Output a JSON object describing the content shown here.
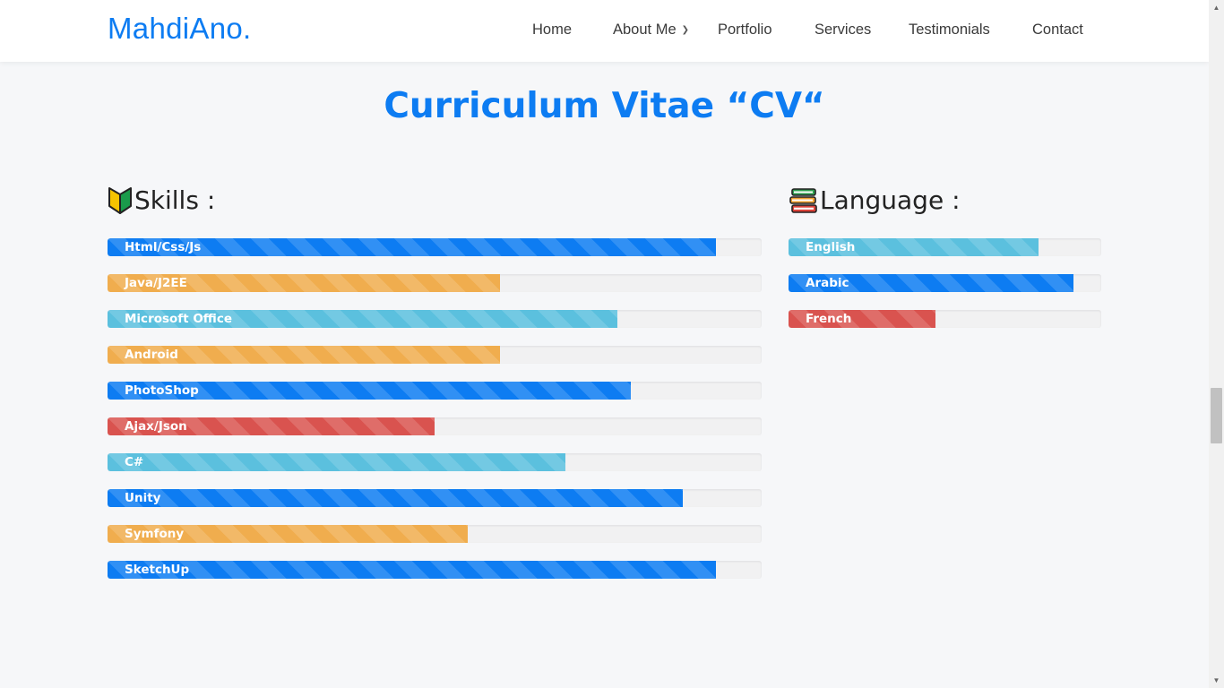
{
  "nav": {
    "brand": "MahdiAno.",
    "items": [
      {
        "label": "Home"
      },
      {
        "label": "About Me",
        "dropdown": true
      },
      {
        "label": "Portfolio"
      },
      {
        "label": "Services"
      },
      {
        "label": "Testimonials"
      },
      {
        "label": "Contact"
      }
    ]
  },
  "title": "Curriculum Vitae “CV“",
  "skills": {
    "heading": "Skills :",
    "icon": "beginner-mark-icon",
    "items": [
      {
        "label": "Html/Css/Js",
        "percent": 93,
        "color": "#0d7cf2"
      },
      {
        "label": "Java/J2EE",
        "percent": 60,
        "color": "#f0ad4e"
      },
      {
        "label": "Microsoft Office",
        "percent": 78,
        "color": "#5bc0de"
      },
      {
        "label": "Android",
        "percent": 60,
        "color": "#f0ad4e"
      },
      {
        "label": "PhotoShop",
        "percent": 80,
        "color": "#0d7cf2"
      },
      {
        "label": "Ajax/Json",
        "percent": 50,
        "color": "#d9534f"
      },
      {
        "label": "C#",
        "percent": 70,
        "color": "#5bc0de"
      },
      {
        "label": "Unity",
        "percent": 88,
        "color": "#0d7cf2"
      },
      {
        "label": "Symfony",
        "percent": 55,
        "color": "#f0ad4e"
      },
      {
        "label": "SketchUp",
        "percent": 93,
        "color": "#0d7cf2"
      }
    ]
  },
  "languages": {
    "heading": "Language :",
    "icon": "books-icon",
    "items": [
      {
        "label": "English",
        "percent": 80,
        "color": "#5bc0de"
      },
      {
        "label": "Arabic",
        "percent": 91,
        "color": "#0d7cf2"
      },
      {
        "label": "French",
        "percent": 47,
        "color": "#d9534f"
      }
    ]
  }
}
